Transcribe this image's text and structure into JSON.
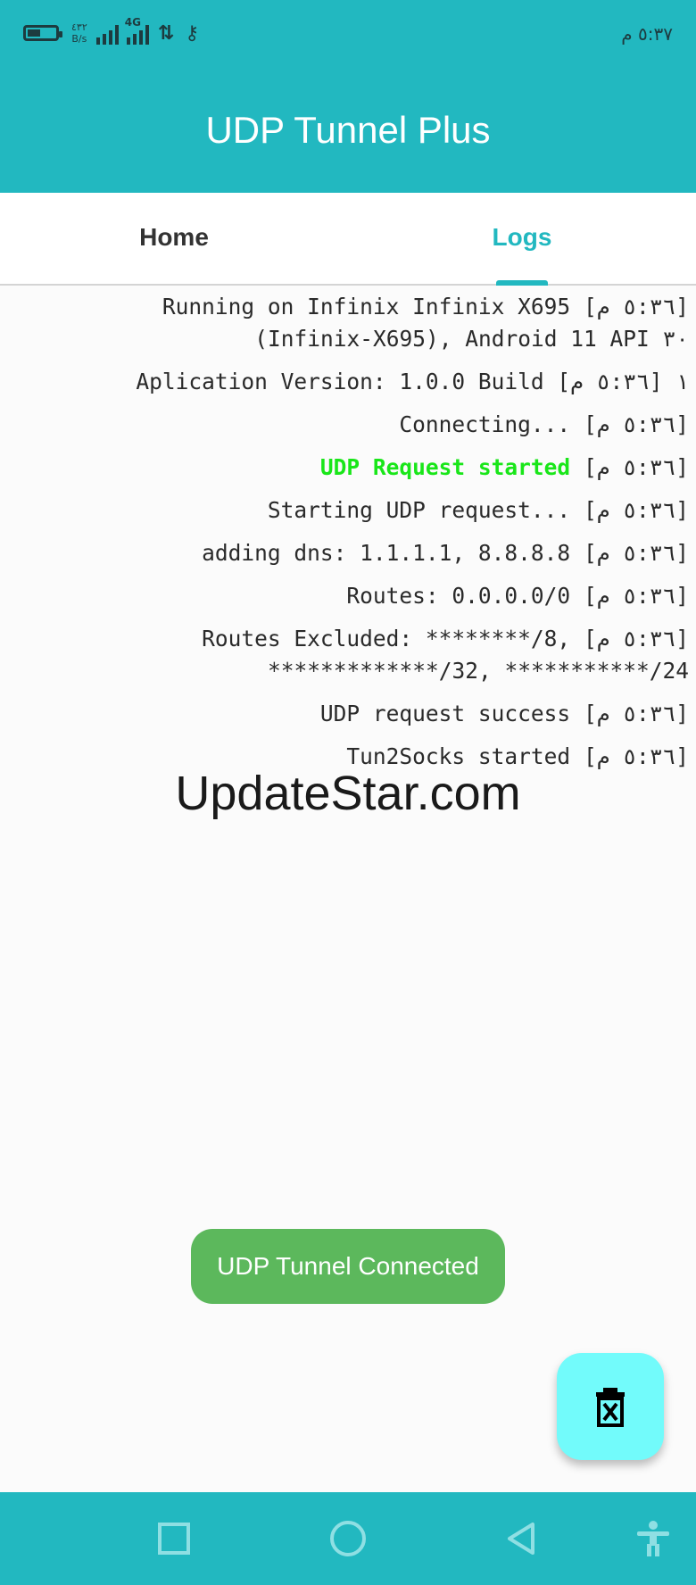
{
  "status_bar": {
    "net_speed_value": "٤٣٢",
    "net_speed_unit": "B/s",
    "network_type": "4G",
    "data_arrows": "⇅",
    "key_glyph": "⚷",
    "time": "٥:٣٧ م"
  },
  "app_bar": {
    "title": "UDP Tunnel Plus"
  },
  "tabs": [
    {
      "label": "Home",
      "selected": false
    },
    {
      "label": "Logs",
      "selected": true
    }
  ],
  "logs": [
    {
      "time": "[٥:٣٦ م]",
      "lines": [
        "Running on Infinix Infinix X695",
        "(Infinix-X695), Android 11 API ٣٠"
      ]
    },
    {
      "time": "[٥:٣٦ م]",
      "lines": [
        "Aplication Version: 1.0.0 Build ١"
      ]
    },
    {
      "time": "[٥:٣٦ م]",
      "lines": [
        "Connecting..."
      ]
    },
    {
      "time": "[٥:٣٦ م]",
      "lines": [
        "UDP Request started"
      ],
      "color": "#19e619"
    },
    {
      "time": "[٥:٣٦ م]",
      "lines": [
        "Starting UDP request..."
      ]
    },
    {
      "time": "[٥:٣٦ م]",
      "lines": [
        "adding dns: 1.1.1.1, 8.8.8.8"
      ]
    },
    {
      "time": "[٥:٣٦ م]",
      "lines": [
        "Routes: 0.0.0.0/0"
      ]
    },
    {
      "time": "[٥:٣٦ م]",
      "lines": [
        "Routes Excluded: ********/8,",
        "*************/32, ***********/24"
      ]
    },
    {
      "time": "[٥:٣٦ م]",
      "lines": [
        "UDP request success"
      ]
    },
    {
      "time": "[٥:٣٦ م]",
      "lines": [
        "Tun2Socks started"
      ]
    }
  ],
  "watermark": "UpdateStar.com",
  "toast": {
    "text": "UDP Tunnel Connected"
  },
  "fab": {
    "icon": "clear-logs-icon"
  },
  "nav_bar": {
    "icons": [
      "recents-square-icon",
      "home-circle-icon",
      "back-triangle-icon",
      "accessibility-icon"
    ]
  },
  "colors": {
    "primary": "#22b8c0",
    "fab": "#72fbfb",
    "toast": "#5cb85c",
    "log_highlight": "#19e619"
  }
}
